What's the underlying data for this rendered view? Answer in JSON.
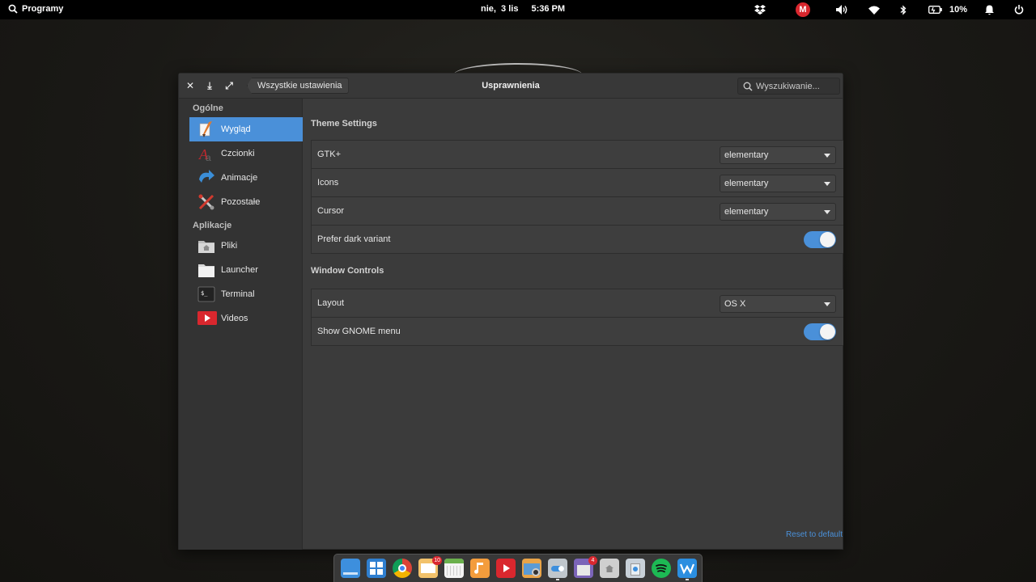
{
  "panel": {
    "applications_label": "Programy",
    "date": "nie,  3 lis",
    "time": "5:36 PM",
    "battery": "10%",
    "mega_label": "M"
  },
  "window": {
    "title": "Usprawnienia",
    "back_label": "Wszystkie ustawienia",
    "search_placeholder": "Wyszukiwanie...",
    "close_glyph": "✕",
    "download_glyph": "⤓",
    "maximize_glyph": "⤢"
  },
  "sidebar": {
    "header_general": "Ogólne",
    "header_apps": "Aplikacje",
    "general_items": [
      {
        "label": "Wygląd",
        "icon": "appearance-icon",
        "active": true
      },
      {
        "label": "Czcionki",
        "icon": "fonts-icon"
      },
      {
        "label": "Animacje",
        "icon": "animations-icon"
      },
      {
        "label": "Pozostałe",
        "icon": "misc-icon"
      }
    ],
    "app_items": [
      {
        "label": "Pliki",
        "icon": "files-icon"
      },
      {
        "label": "Launcher",
        "icon": "launcher-icon"
      },
      {
        "label": "Terminal",
        "icon": "terminal-icon"
      },
      {
        "label": "Videos",
        "icon": "videos-icon"
      }
    ]
  },
  "content": {
    "theme_section": "Theme Settings",
    "theme_rows": [
      {
        "label": "GTK+",
        "value": "elementary"
      },
      {
        "label": "Icons",
        "value": "elementary"
      },
      {
        "label": "Cursor",
        "value": "elementary"
      },
      {
        "label": "Prefer dark variant",
        "toggle": true
      }
    ],
    "window_section": "Window Controls",
    "window_rows": [
      {
        "label": "Layout",
        "value": "OS X"
      },
      {
        "label": "Show GNOME menu",
        "toggle": true
      }
    ],
    "reset_label": "Reset to default"
  },
  "dock": {
    "badge_mail": "10",
    "badge_store": "4",
    "items": [
      "multitasking-icon",
      "workspaces-icon",
      "chrome-icon",
      "mail-icon",
      "calendar-icon",
      "music-icon",
      "videos-icon",
      "photos-icon",
      "settings-icon",
      "appcenter-icon",
      "files-icon",
      "trash-icon",
      "spotify-icon",
      "wps-writer-icon"
    ]
  },
  "colors": {
    "accent": "#4a90d9",
    "badge": "#d9272e"
  }
}
